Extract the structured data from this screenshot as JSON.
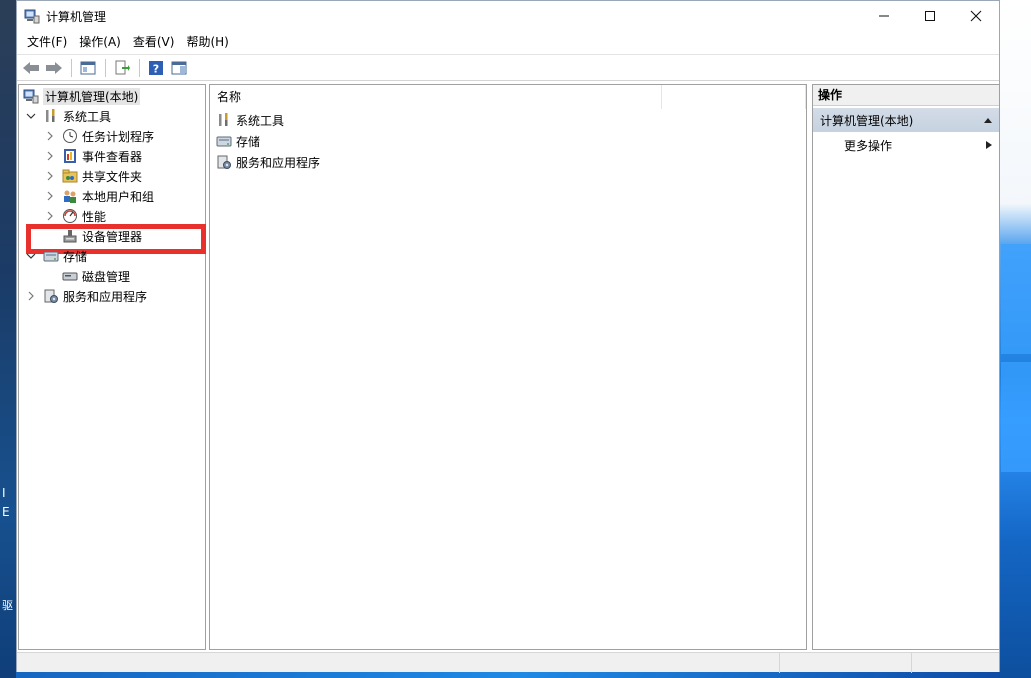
{
  "window": {
    "title": "计算机管理",
    "minimize": "—",
    "maximize": "☐",
    "close": "✕"
  },
  "menu": [
    "文件(F)",
    "操作(A)",
    "查看(V)",
    "帮助(H)"
  ],
  "tree": {
    "root": "计算机管理(本地)",
    "system_tools": "系统工具",
    "task_scheduler": "任务计划程序",
    "event_viewer": "事件查看器",
    "shared_folders": "共享文件夹",
    "local_users": "本地用户和组",
    "performance": "性能",
    "device_manager": "设备管理器",
    "storage": "存储",
    "disk_management": "磁盘管理",
    "services_apps": "服务和应用程序"
  },
  "list": {
    "column_name": "名称",
    "items": [
      "系统工具",
      "存储",
      "服务和应用程序"
    ]
  },
  "actions": {
    "header": "操作",
    "section": "计算机管理(本地)",
    "more": "更多操作"
  },
  "desktop": {
    "glyphs": [
      "I",
      "E",
      "驱"
    ]
  },
  "colors": {
    "highlight_border": "#e8302d",
    "action_section_bg": "#c9d5e3",
    "root_selected_bg": "#e5e5e5"
  }
}
